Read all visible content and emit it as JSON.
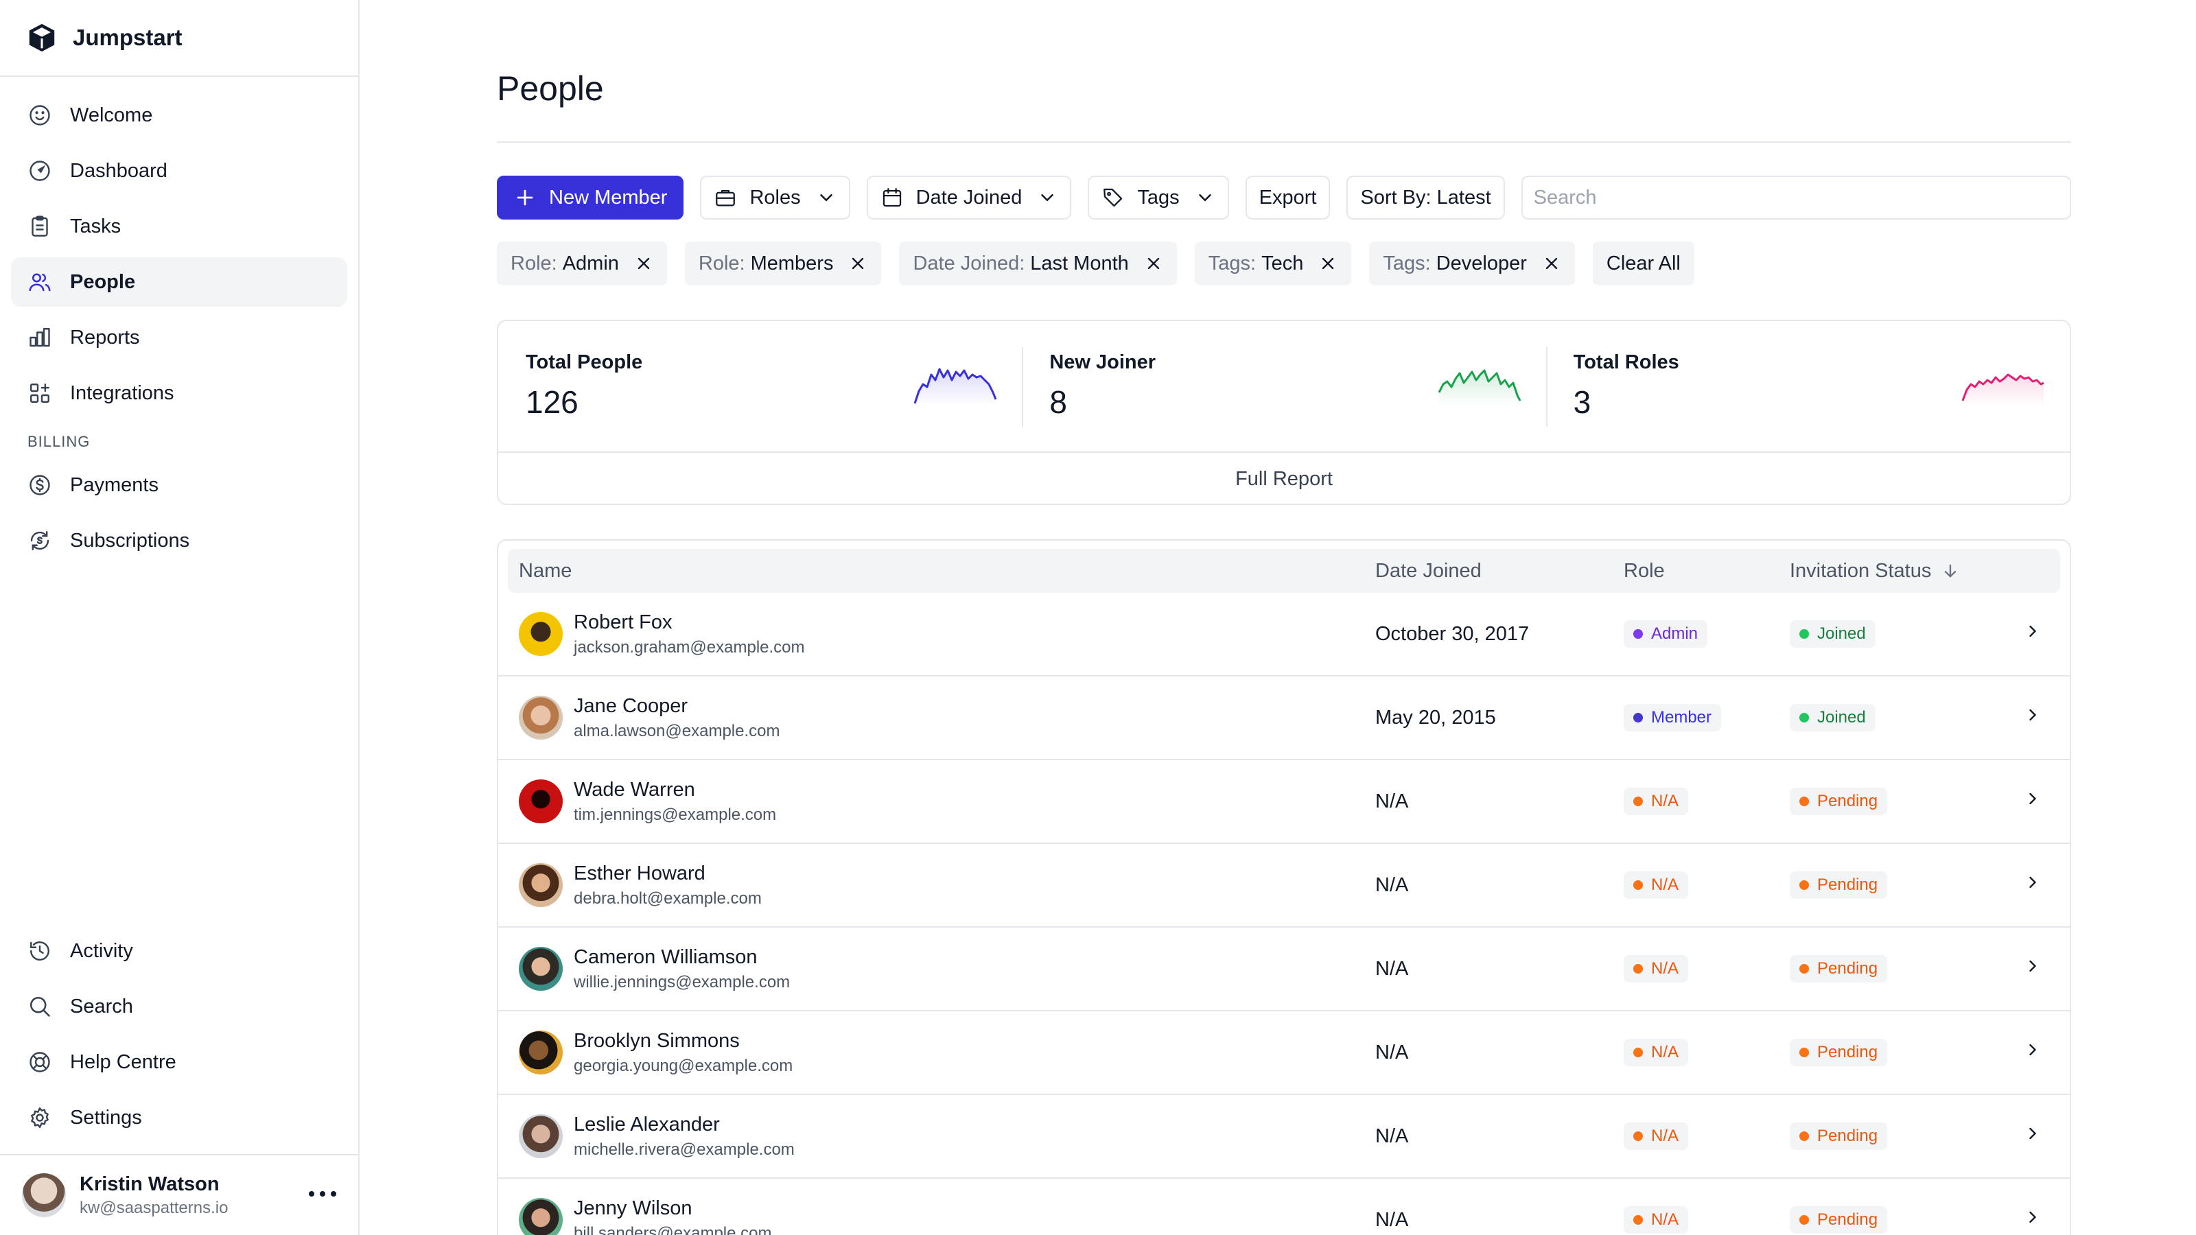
{
  "app": {
    "name": "Jumpstart"
  },
  "sidebar": {
    "items": [
      {
        "label": "Welcome",
        "icon": "smile-icon"
      },
      {
        "label": "Dashboard",
        "icon": "gauge-icon"
      },
      {
        "label": "Tasks",
        "icon": "clipboard-icon"
      },
      {
        "label": "People",
        "icon": "users-icon",
        "active": true
      },
      {
        "label": "Reports",
        "icon": "bar-chart-icon"
      },
      {
        "label": "Integrations",
        "icon": "grid-plus-icon"
      }
    ],
    "billing_section": "BILLING",
    "billing_items": [
      {
        "label": "Payments",
        "icon": "dollar-circle-icon"
      },
      {
        "label": "Subscriptions",
        "icon": "refresh-dollar-icon"
      }
    ],
    "bottom_items": [
      {
        "label": "Activity",
        "icon": "history-icon"
      },
      {
        "label": "Search",
        "icon": "search-icon"
      },
      {
        "label": "Help Centre",
        "icon": "lifebuoy-icon"
      },
      {
        "label": "Settings",
        "icon": "gear-icon"
      }
    ],
    "user": {
      "name": "Kristin Watson",
      "email": "kw@saaspatterns.io"
    }
  },
  "page": {
    "title": "People"
  },
  "toolbar": {
    "new_member": "New Member",
    "roles": "Roles",
    "date_joined": "Date Joined",
    "tags": "Tags",
    "export": "Export",
    "sort": "Sort By: Latest",
    "search_placeholder": "Search"
  },
  "filters": [
    {
      "key": "Role:",
      "value": "Admin"
    },
    {
      "key": "Role:",
      "value": "Members"
    },
    {
      "key": "Date Joined:",
      "value": "Last Month"
    },
    {
      "key": "Tags:",
      "value": "Tech"
    },
    {
      "key": "Tags:",
      "value": "Developer"
    }
  ],
  "clear_all": "Clear All",
  "stats": [
    {
      "label": "Total People",
      "value": "126",
      "color": "#3730d9"
    },
    {
      "label": "New Joiner",
      "value": "8",
      "color": "#16a34a"
    },
    {
      "label": "Total Roles",
      "value": "3",
      "color": "#e11d74"
    }
  ],
  "full_report": "Full Report",
  "table": {
    "columns": {
      "name": "Name",
      "date": "Date Joined",
      "role": "Role",
      "status": "Invitation Status"
    },
    "rows": [
      {
        "name": "Robert Fox",
        "email": "jackson.graham@example.com",
        "date": "October 30, 2017",
        "role": "Admin",
        "status": "Joined"
      },
      {
        "name": "Jane Cooper",
        "email": "alma.lawson@example.com",
        "date": "May 20, 2015",
        "role": "Member",
        "status": "Joined"
      },
      {
        "name": "Wade Warren",
        "email": "tim.jennings@example.com",
        "date": "N/A",
        "role": "N/A",
        "status": "Pending"
      },
      {
        "name": "Esther Howard",
        "email": "debra.holt@example.com",
        "date": "N/A",
        "role": "N/A",
        "status": "Pending"
      },
      {
        "name": "Cameron Williamson",
        "email": "willie.jennings@example.com",
        "date": "N/A",
        "role": "N/A",
        "status": "Pending"
      },
      {
        "name": "Brooklyn Simmons",
        "email": "georgia.young@example.com",
        "date": "N/A",
        "role": "N/A",
        "status": "Pending"
      },
      {
        "name": "Leslie Alexander",
        "email": "michelle.rivera@example.com",
        "date": "N/A",
        "role": "N/A",
        "status": "Pending"
      },
      {
        "name": "Jenny Wilson",
        "email": "bill.sanders@example.com",
        "date": "N/A",
        "role": "N/A",
        "status": "Pending"
      }
    ]
  }
}
